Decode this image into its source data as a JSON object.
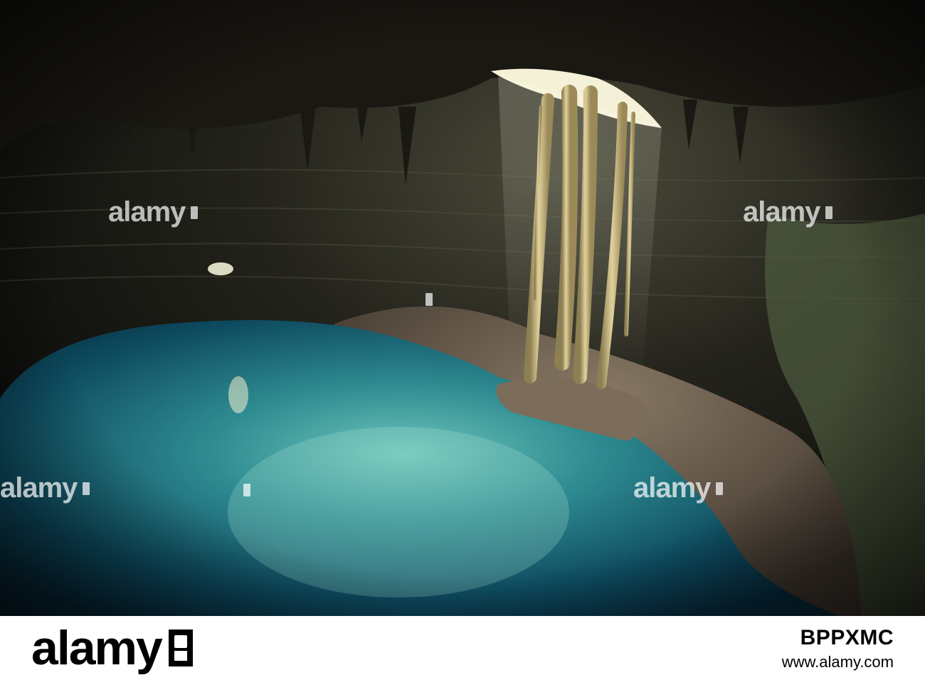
{
  "watermark": {
    "text": "alamy"
  },
  "footer": {
    "logo": "alamy",
    "image_id": "BPPXMC",
    "site": "www.alamy.com"
  },
  "colors": {
    "water_deep": "#0a3a4c",
    "water_light": "#5fb8b0",
    "roots": "#d6c48e",
    "rock_dark": "#15140f"
  }
}
